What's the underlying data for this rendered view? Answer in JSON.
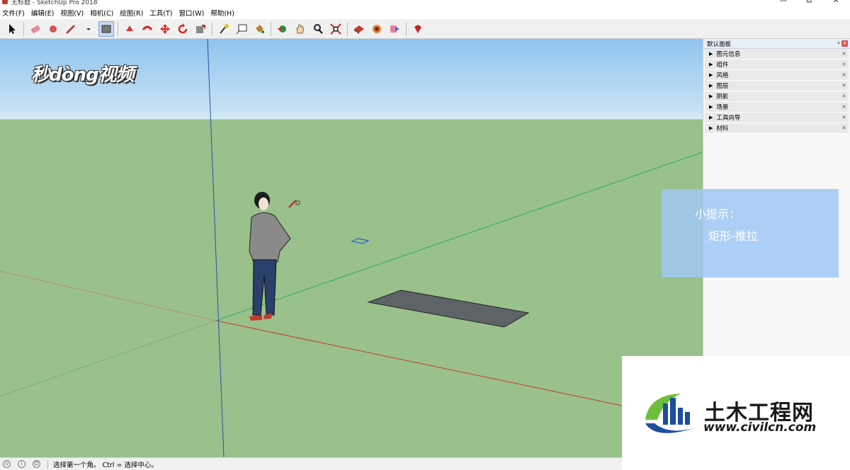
{
  "window": {
    "title": "无标题 - SketchUp Pro 2018",
    "minimize": "—",
    "maximize": "⧉",
    "close": "✕"
  },
  "menu": [
    "文件(F)",
    "编辑(E)",
    "视图(V)",
    "相机(C)",
    "绘图(R)",
    "工具(T)",
    "窗口(W)",
    "帮助(H)"
  ],
  "toolbar": {
    "tools": [
      "select",
      "eraser",
      "paint",
      "rectangle",
      "line",
      "arc",
      "move",
      "rotate",
      "scale",
      "pushpull",
      "tape",
      "text",
      "paint-bucket",
      "orbit",
      "pan",
      "zoom",
      "zoom-extents",
      "warehouse",
      "extension",
      "send",
      "ruby"
    ],
    "active_tool": "rectangle"
  },
  "overlay_logo": "秒dòng视频",
  "tray": {
    "title": "默认面板",
    "pin": "ᵖ",
    "close": "x",
    "items": [
      "图元信息",
      "组件",
      "风格",
      "图层",
      "阴影",
      "场景",
      "工具向导",
      "材料"
    ]
  },
  "tip": {
    "title": "小提示：",
    "body": "矩形-推拉"
  },
  "civil_logo": {
    "name": "土木工程网",
    "url": "www.civilcn.com"
  },
  "status": {
    "message": "选择第一个角。 Ctrl = 选择中心。"
  },
  "colors": {
    "sky": "#8fc4ef",
    "ground": "#9ac08c",
    "axis_red": "#c0392b",
    "axis_green": "#27ae60",
    "axis_blue": "#2d4fa8",
    "rectangle_fill": "#5e6367"
  }
}
